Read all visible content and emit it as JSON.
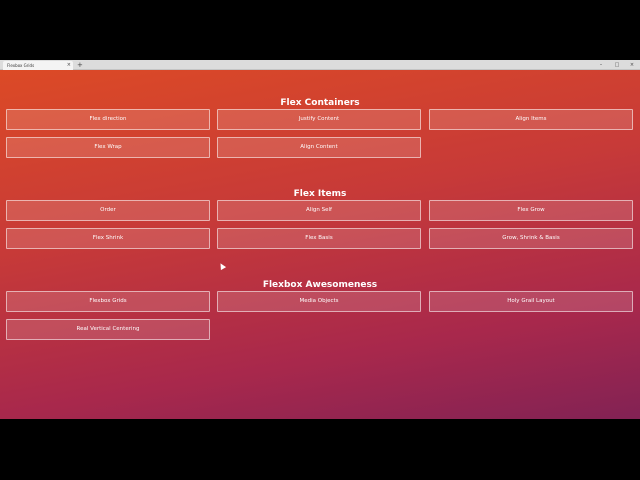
{
  "browser": {
    "tab_title": "Flexbox Grids",
    "tab_close": "×",
    "new_tab": "+",
    "controls": {
      "minimize": "–",
      "maximize": "□",
      "close": "×"
    }
  },
  "sections": [
    {
      "title": "Flex Containers",
      "buttons": [
        "Flex direction",
        "Justify Content",
        "Align Items",
        "Flex Wrap",
        "Align Content"
      ]
    },
    {
      "title": "Flex Items",
      "buttons": [
        "Order",
        "Align Self",
        "Flex Grow",
        "Flex Shrink",
        "Flex Basis",
        "Grow, Shrink & Basis"
      ]
    },
    {
      "title": "Flexbox Awesomeness",
      "buttons": [
        "Flexbox Grids",
        "Media Objects",
        "Holy Grail Layout",
        "Real Vertical Centering"
      ]
    }
  ]
}
